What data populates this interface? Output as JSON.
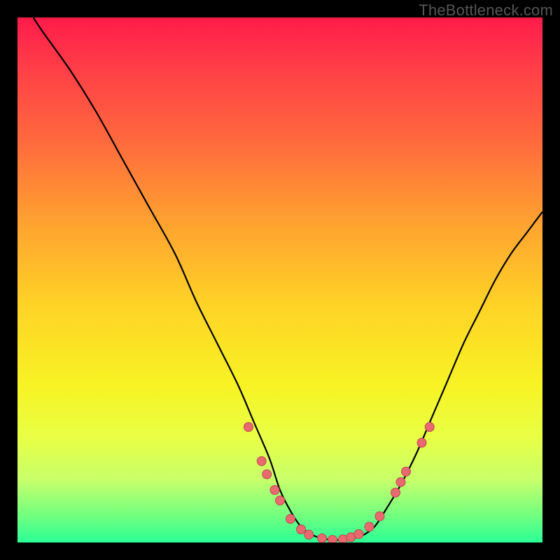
{
  "watermark": "TheBottleneck.com",
  "colors": {
    "background": "#000000",
    "curve": "#000000",
    "dot_fill": "#e86a6f",
    "dot_stroke": "#b94c51",
    "gradient_stops": [
      "#ff1b4a",
      "#ff3f47",
      "#ff6b3d",
      "#ffa52f",
      "#ffd326",
      "#f7f323",
      "#e8ff45",
      "#c8ff6a",
      "#7dff7d",
      "#2bff96"
    ]
  },
  "chart_data": {
    "type": "line",
    "title": "",
    "xlabel": "",
    "ylabel": "",
    "xlim": [
      0,
      100
    ],
    "ylim": [
      0,
      100
    ],
    "series": [
      {
        "name": "curve",
        "x": [
          3,
          5,
          10,
          15,
          20,
          25,
          30,
          34,
          38,
          42,
          45,
          48,
          50,
          52,
          54,
          56,
          58,
          60,
          62,
          64,
          66,
          68,
          70,
          73,
          76,
          79,
          82,
          85,
          88,
          91,
          94,
          97,
          100
        ],
        "y": [
          100,
          97,
          90,
          82,
          73,
          64,
          55,
          46,
          38,
          30,
          23,
          16,
          10,
          6,
          3,
          1.5,
          0.8,
          0.5,
          0.5,
          0.8,
          1.5,
          3,
          6,
          11,
          17,
          24,
          31,
          38,
          44,
          50,
          55,
          59,
          63
        ]
      }
    ],
    "points": [
      {
        "name": "p1",
        "x": 44,
        "y": 22
      },
      {
        "name": "p2",
        "x": 46.5,
        "y": 15.5
      },
      {
        "name": "p3",
        "x": 47.5,
        "y": 13
      },
      {
        "name": "p4",
        "x": 49,
        "y": 10
      },
      {
        "name": "p5",
        "x": 50,
        "y": 8
      },
      {
        "name": "p6",
        "x": 52,
        "y": 4.5
      },
      {
        "name": "p7",
        "x": 54,
        "y": 2.5
      },
      {
        "name": "p8",
        "x": 55.5,
        "y": 1.5
      },
      {
        "name": "p9",
        "x": 58,
        "y": 0.8
      },
      {
        "name": "p10",
        "x": 60,
        "y": 0.5
      },
      {
        "name": "p11",
        "x": 62,
        "y": 0.6
      },
      {
        "name": "p12",
        "x": 63.5,
        "y": 1
      },
      {
        "name": "p13",
        "x": 65,
        "y": 1.6
      },
      {
        "name": "p14",
        "x": 67,
        "y": 3
      },
      {
        "name": "p15",
        "x": 69,
        "y": 5
      },
      {
        "name": "p16",
        "x": 72,
        "y": 9.5
      },
      {
        "name": "p17",
        "x": 73,
        "y": 11.5
      },
      {
        "name": "p18",
        "x": 74,
        "y": 13.5
      },
      {
        "name": "p19",
        "x": 77,
        "y": 19
      },
      {
        "name": "p20",
        "x": 78.5,
        "y": 22
      }
    ]
  }
}
